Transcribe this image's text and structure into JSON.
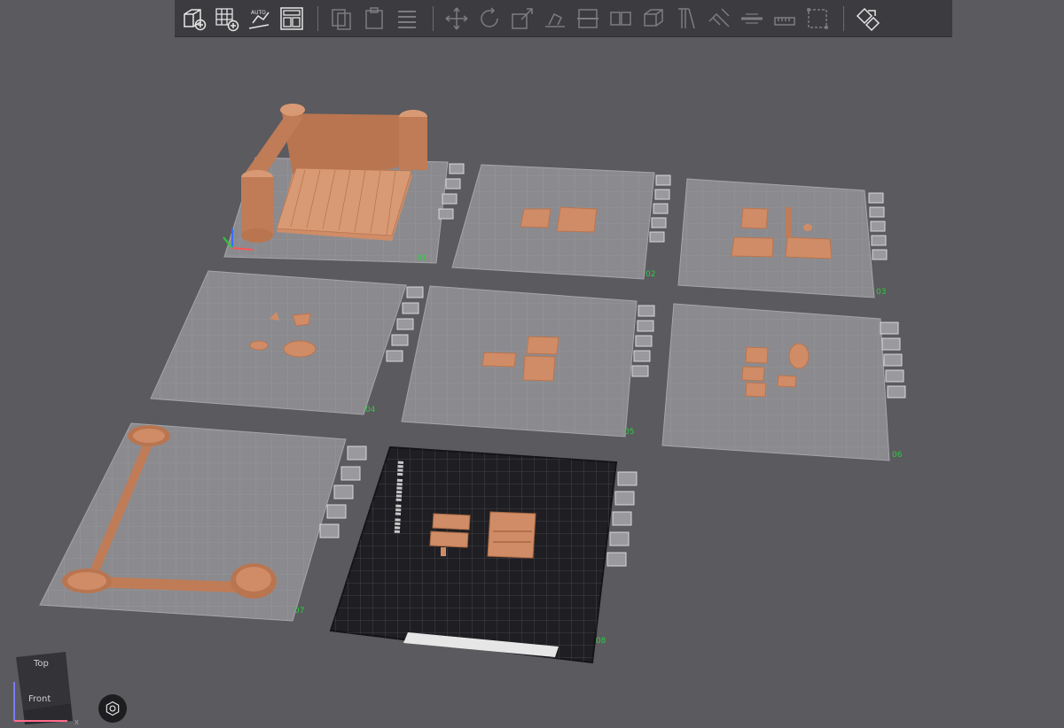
{
  "toolbar": {
    "buttons": [
      {
        "icon": "add-cube-icon",
        "enabled": true
      },
      {
        "icon": "add-plate-icon",
        "enabled": true
      },
      {
        "icon": "auto-orient-icon",
        "enabled": true,
        "label": "AUTO"
      },
      {
        "icon": "arrange-icon",
        "enabled": true
      },
      {
        "icon": "copy-icon",
        "enabled": false
      },
      {
        "icon": "paste-icon",
        "enabled": false
      },
      {
        "icon": "delete-icon",
        "enabled": false
      },
      {
        "icon": "move-icon",
        "enabled": false
      },
      {
        "icon": "rotate-icon",
        "enabled": false
      },
      {
        "icon": "scale-icon",
        "enabled": false
      },
      {
        "icon": "lay-on-face-icon",
        "enabled": false
      },
      {
        "icon": "cut-icon",
        "enabled": false
      },
      {
        "icon": "split-objects-icon",
        "enabled": false
      },
      {
        "icon": "split-parts-icon",
        "enabled": false
      },
      {
        "icon": "support-paint-icon",
        "enabled": false
      },
      {
        "icon": "seam-paint-icon",
        "enabled": false
      },
      {
        "icon": "mirror-icon",
        "enabled": false
      },
      {
        "icon": "measure-icon",
        "enabled": false
      },
      {
        "icon": "text-emboss-icon",
        "enabled": false
      },
      {
        "icon": "variable-layer-icon",
        "enabled": false
      },
      {
        "icon": "assemble-icon",
        "enabled": true
      }
    ]
  },
  "viewcube": {
    "top_label": "Top",
    "front_label": "Front",
    "x_axis": "X"
  },
  "plates": [
    {
      "index": "01"
    },
    {
      "index": "02"
    },
    {
      "index": "03"
    },
    {
      "index": "04"
    },
    {
      "index": "05"
    },
    {
      "index": "06"
    },
    {
      "index": "07"
    },
    {
      "index": "08",
      "selected": true
    }
  ],
  "colors": {
    "background": "#5a5a5f",
    "plate": "#8b8b8f",
    "model": "#d08c66",
    "plate_label": "#2ecc40"
  }
}
